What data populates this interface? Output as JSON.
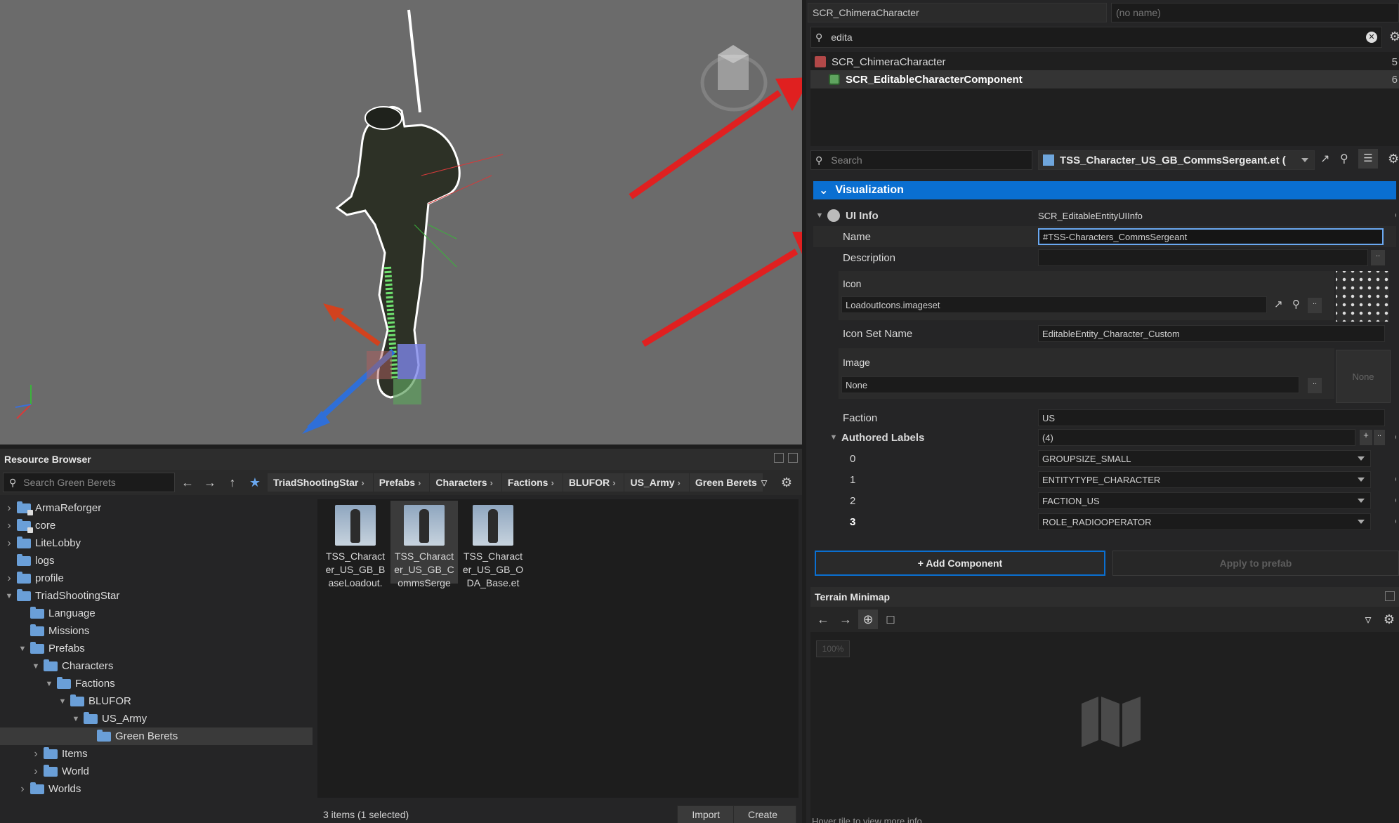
{
  "resource_browser": {
    "title": "Resource Browser",
    "search_placeholder": "Search Green Berets",
    "breadcrumbs": [
      "TriadShootingStar",
      "Prefabs",
      "Characters",
      "Factions",
      "BLUFOR",
      "US_Army",
      "Green Berets"
    ],
    "tree": [
      {
        "label": "ArmaReforger",
        "indent": 0,
        "expanded": false,
        "locked": true
      },
      {
        "label": "core",
        "indent": 0,
        "expanded": false,
        "locked": true
      },
      {
        "label": "LiteLobby",
        "indent": 0,
        "expanded": false
      },
      {
        "label": "logs",
        "indent": 0,
        "expanded": null
      },
      {
        "label": "profile",
        "indent": 0,
        "expanded": false
      },
      {
        "label": "TriadShootingStar",
        "indent": 0,
        "expanded": true
      },
      {
        "label": "Language",
        "indent": 1,
        "expanded": null
      },
      {
        "label": "Missions",
        "indent": 1,
        "expanded": null
      },
      {
        "label": "Prefabs",
        "indent": 1,
        "expanded": true
      },
      {
        "label": "Characters",
        "indent": 2,
        "expanded": true
      },
      {
        "label": "Factions",
        "indent": 3,
        "expanded": true
      },
      {
        "label": "BLUFOR",
        "indent": 4,
        "expanded": true
      },
      {
        "label": "US_Army",
        "indent": 5,
        "expanded": true
      },
      {
        "label": "Green Berets",
        "indent": 6,
        "expanded": null,
        "selected": true
      },
      {
        "label": "Items",
        "indent": 2,
        "expanded": false
      },
      {
        "label": "World",
        "indent": 2,
        "expanded": false
      },
      {
        "label": "Worlds",
        "indent": 1,
        "expanded": false
      }
    ],
    "files": [
      {
        "lines": [
          "TSS_Charact",
          "er_US_GB_B",
          "aseLoadout."
        ]
      },
      {
        "lines": [
          "TSS_Charact",
          "er_US_GB_C",
          "ommsSerge"
        ],
        "selected": true
      },
      {
        "lines": [
          "TSS_Charact",
          "er_US_GB_O",
          "DA_Base.et"
        ]
      }
    ],
    "status": "3 items (1 selected)",
    "import_label": "Import",
    "create_label": "Create"
  },
  "inspector": {
    "class_name": "SCR_ChimeraCharacter",
    "entity_name_placeholder": "(no name)",
    "filter_value": "edita",
    "hierarchy": [
      {
        "label": "SCR_ChimeraCharacter",
        "count": "5"
      },
      {
        "label": "SCR_EditableCharacterComponent",
        "count": "6"
      }
    ],
    "search_placeholder": "Search",
    "prefab_label": "TSS_Character_US_GB_CommsSergeant.et (",
    "section": "Visualization",
    "ui_info_label": "UI Info",
    "ui_info_value": "SCR_EditableEntityUIInfo",
    "name_label": "Name",
    "name_value": "#TSS-Characters_CommsSergeant",
    "description_label": "Description",
    "icon_label": "Icon",
    "icon_value": "LoadoutIcons.imageset",
    "icon_set_name_label": "Icon Set Name",
    "icon_set_name_value": "EditableEntity_Character_Custom",
    "image_label": "Image",
    "image_value": "None",
    "image_preview": "None",
    "faction_label": "Faction",
    "faction_value": "US",
    "authored_labels_label": "Authored Labels",
    "authored_labels_count": "(4)",
    "labels": [
      {
        "index": "0",
        "value": "GROUPSIZE_SMALL"
      },
      {
        "index": "1",
        "value": "ENTITYTYPE_CHARACTER"
      },
      {
        "index": "2",
        "value": "FACTION_US"
      },
      {
        "index": "3",
        "value": "ROLE_RADIOOPERATOR"
      }
    ],
    "add_component": "+ Add Component",
    "apply_to_prefab": "Apply to prefab"
  },
  "minimap": {
    "title": "Terrain Minimap",
    "zoom": "100%",
    "hint": "Hover tile to view more info"
  },
  "colors": {
    "accent": "#0a6fd1",
    "arrow": "#e02020"
  }
}
